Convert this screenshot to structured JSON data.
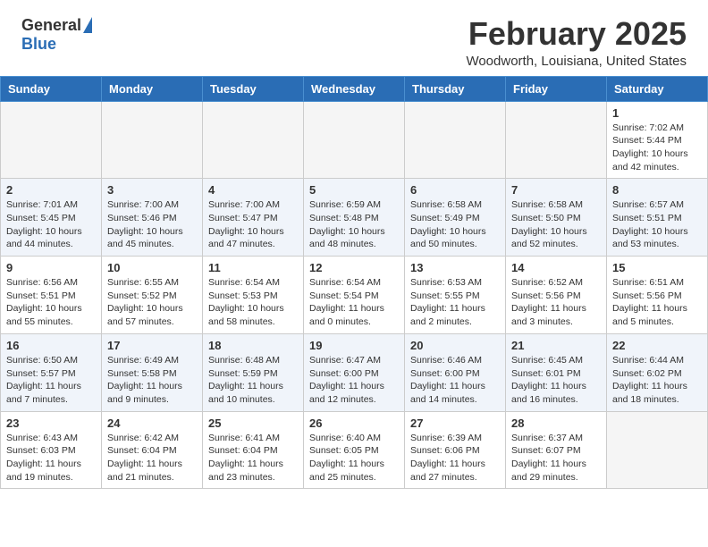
{
  "header": {
    "logo_general": "General",
    "logo_blue": "Blue",
    "title": "February 2025",
    "subtitle": "Woodworth, Louisiana, United States"
  },
  "weekdays": [
    "Sunday",
    "Monday",
    "Tuesday",
    "Wednesday",
    "Thursday",
    "Friday",
    "Saturday"
  ],
  "weeks": [
    [
      {
        "day": "",
        "info": ""
      },
      {
        "day": "",
        "info": ""
      },
      {
        "day": "",
        "info": ""
      },
      {
        "day": "",
        "info": ""
      },
      {
        "day": "",
        "info": ""
      },
      {
        "day": "",
        "info": ""
      },
      {
        "day": "1",
        "info": "Sunrise: 7:02 AM\nSunset: 5:44 PM\nDaylight: 10 hours and 42 minutes."
      }
    ],
    [
      {
        "day": "2",
        "info": "Sunrise: 7:01 AM\nSunset: 5:45 PM\nDaylight: 10 hours and 44 minutes."
      },
      {
        "day": "3",
        "info": "Sunrise: 7:00 AM\nSunset: 5:46 PM\nDaylight: 10 hours and 45 minutes."
      },
      {
        "day": "4",
        "info": "Sunrise: 7:00 AM\nSunset: 5:47 PM\nDaylight: 10 hours and 47 minutes."
      },
      {
        "day": "5",
        "info": "Sunrise: 6:59 AM\nSunset: 5:48 PM\nDaylight: 10 hours and 48 minutes."
      },
      {
        "day": "6",
        "info": "Sunrise: 6:58 AM\nSunset: 5:49 PM\nDaylight: 10 hours and 50 minutes."
      },
      {
        "day": "7",
        "info": "Sunrise: 6:58 AM\nSunset: 5:50 PM\nDaylight: 10 hours and 52 minutes."
      },
      {
        "day": "8",
        "info": "Sunrise: 6:57 AM\nSunset: 5:51 PM\nDaylight: 10 hours and 53 minutes."
      }
    ],
    [
      {
        "day": "9",
        "info": "Sunrise: 6:56 AM\nSunset: 5:51 PM\nDaylight: 10 hours and 55 minutes."
      },
      {
        "day": "10",
        "info": "Sunrise: 6:55 AM\nSunset: 5:52 PM\nDaylight: 10 hours and 57 minutes."
      },
      {
        "day": "11",
        "info": "Sunrise: 6:54 AM\nSunset: 5:53 PM\nDaylight: 10 hours and 58 minutes."
      },
      {
        "day": "12",
        "info": "Sunrise: 6:54 AM\nSunset: 5:54 PM\nDaylight: 11 hours and 0 minutes."
      },
      {
        "day": "13",
        "info": "Sunrise: 6:53 AM\nSunset: 5:55 PM\nDaylight: 11 hours and 2 minutes."
      },
      {
        "day": "14",
        "info": "Sunrise: 6:52 AM\nSunset: 5:56 PM\nDaylight: 11 hours and 3 minutes."
      },
      {
        "day": "15",
        "info": "Sunrise: 6:51 AM\nSunset: 5:56 PM\nDaylight: 11 hours and 5 minutes."
      }
    ],
    [
      {
        "day": "16",
        "info": "Sunrise: 6:50 AM\nSunset: 5:57 PM\nDaylight: 11 hours and 7 minutes."
      },
      {
        "day": "17",
        "info": "Sunrise: 6:49 AM\nSunset: 5:58 PM\nDaylight: 11 hours and 9 minutes."
      },
      {
        "day": "18",
        "info": "Sunrise: 6:48 AM\nSunset: 5:59 PM\nDaylight: 11 hours and 10 minutes."
      },
      {
        "day": "19",
        "info": "Sunrise: 6:47 AM\nSunset: 6:00 PM\nDaylight: 11 hours and 12 minutes."
      },
      {
        "day": "20",
        "info": "Sunrise: 6:46 AM\nSunset: 6:00 PM\nDaylight: 11 hours and 14 minutes."
      },
      {
        "day": "21",
        "info": "Sunrise: 6:45 AM\nSunset: 6:01 PM\nDaylight: 11 hours and 16 minutes."
      },
      {
        "day": "22",
        "info": "Sunrise: 6:44 AM\nSunset: 6:02 PM\nDaylight: 11 hours and 18 minutes."
      }
    ],
    [
      {
        "day": "23",
        "info": "Sunrise: 6:43 AM\nSunset: 6:03 PM\nDaylight: 11 hours and 19 minutes."
      },
      {
        "day": "24",
        "info": "Sunrise: 6:42 AM\nSunset: 6:04 PM\nDaylight: 11 hours and 21 minutes."
      },
      {
        "day": "25",
        "info": "Sunrise: 6:41 AM\nSunset: 6:04 PM\nDaylight: 11 hours and 23 minutes."
      },
      {
        "day": "26",
        "info": "Sunrise: 6:40 AM\nSunset: 6:05 PM\nDaylight: 11 hours and 25 minutes."
      },
      {
        "day": "27",
        "info": "Sunrise: 6:39 AM\nSunset: 6:06 PM\nDaylight: 11 hours and 27 minutes."
      },
      {
        "day": "28",
        "info": "Sunrise: 6:37 AM\nSunset: 6:07 PM\nDaylight: 11 hours and 29 minutes."
      },
      {
        "day": "",
        "info": ""
      }
    ]
  ]
}
